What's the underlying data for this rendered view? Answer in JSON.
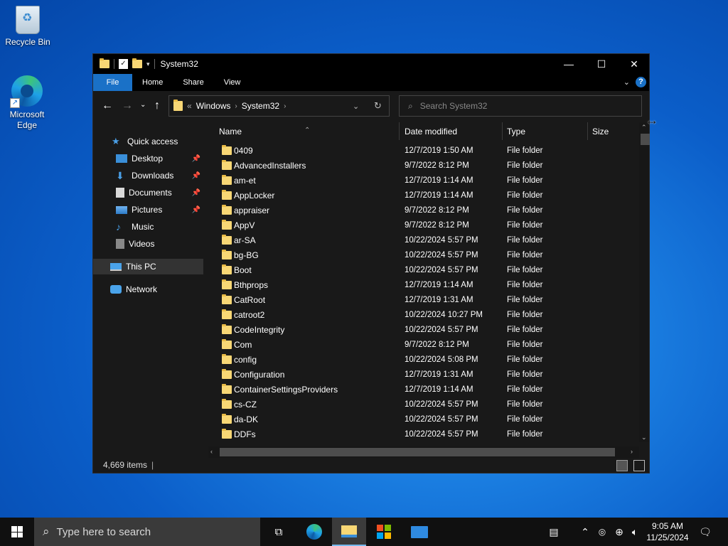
{
  "desktop": {
    "icons": [
      {
        "label": "Recycle Bin",
        "icon": "recycle-bin-icon"
      },
      {
        "label": "Microsoft Edge",
        "icon": "edge-icon"
      }
    ]
  },
  "window": {
    "title": "System32",
    "controls": {
      "minimize": "—",
      "maximize": "☐",
      "close": "✕"
    },
    "ribbon_tabs": [
      "File",
      "Home",
      "Share",
      "View"
    ],
    "help": "?",
    "address": {
      "crumbs": [
        "Windows",
        "System32"
      ],
      "overflow": "«"
    },
    "search_placeholder": "Search System32",
    "nav": {
      "quick_access": "Quick access",
      "pinned": [
        "Desktop",
        "Downloads",
        "Documents",
        "Pictures"
      ],
      "others": [
        "Music",
        "Videos"
      ],
      "this_pc": "This PC",
      "network": "Network"
    },
    "columns": [
      "Name",
      "Date modified",
      "Type",
      "Size"
    ],
    "files": [
      {
        "name": "0409",
        "date": "12/7/2019 1:50 AM",
        "type": "File folder"
      },
      {
        "name": "AdvancedInstallers",
        "date": "9/7/2022 8:12 PM",
        "type": "File folder"
      },
      {
        "name": "am-et",
        "date": "12/7/2019 1:14 AM",
        "type": "File folder"
      },
      {
        "name": "AppLocker",
        "date": "12/7/2019 1:14 AM",
        "type": "File folder"
      },
      {
        "name": "appraiser",
        "date": "9/7/2022 8:12 PM",
        "type": "File folder"
      },
      {
        "name": "AppV",
        "date": "9/7/2022 8:12 PM",
        "type": "File folder"
      },
      {
        "name": "ar-SA",
        "date": "10/22/2024 5:57 PM",
        "type": "File folder"
      },
      {
        "name": "bg-BG",
        "date": "10/22/2024 5:57 PM",
        "type": "File folder"
      },
      {
        "name": "Boot",
        "date": "10/22/2024 5:57 PM",
        "type": "File folder"
      },
      {
        "name": "Bthprops",
        "date": "12/7/2019 1:14 AM",
        "type": "File folder"
      },
      {
        "name": "CatRoot",
        "date": "12/7/2019 1:31 AM",
        "type": "File folder"
      },
      {
        "name": "catroot2",
        "date": "10/22/2024 10:27 PM",
        "type": "File folder"
      },
      {
        "name": "CodeIntegrity",
        "date": "10/22/2024 5:57 PM",
        "type": "File folder"
      },
      {
        "name": "Com",
        "date": "9/7/2022 8:12 PM",
        "type": "File folder"
      },
      {
        "name": "config",
        "date": "10/22/2024 5:08 PM",
        "type": "File folder"
      },
      {
        "name": "Configuration",
        "date": "12/7/2019 1:31 AM",
        "type": "File folder"
      },
      {
        "name": "ContainerSettingsProviders",
        "date": "12/7/2019 1:14 AM",
        "type": "File folder"
      },
      {
        "name": "cs-CZ",
        "date": "10/22/2024 5:57 PM",
        "type": "File folder"
      },
      {
        "name": "da-DK",
        "date": "10/22/2024 5:57 PM",
        "type": "File folder"
      },
      {
        "name": "DDFs",
        "date": "10/22/2024 5:57 PM",
        "type": "File folder"
      }
    ],
    "status": {
      "item_count": "4,669 items"
    }
  },
  "taskbar": {
    "search_placeholder": "Type here to search",
    "apps": [
      "task-view-icon",
      "edge-icon",
      "file-explorer-icon",
      "store-icon",
      "mail-icon"
    ],
    "time": "9:05 AM",
    "date": "11/25/2024"
  },
  "colors": {
    "accent": "#1a71c7",
    "folder": "#f8d775",
    "window_bg": "#191919",
    "taskbar_bg": "#101010"
  }
}
